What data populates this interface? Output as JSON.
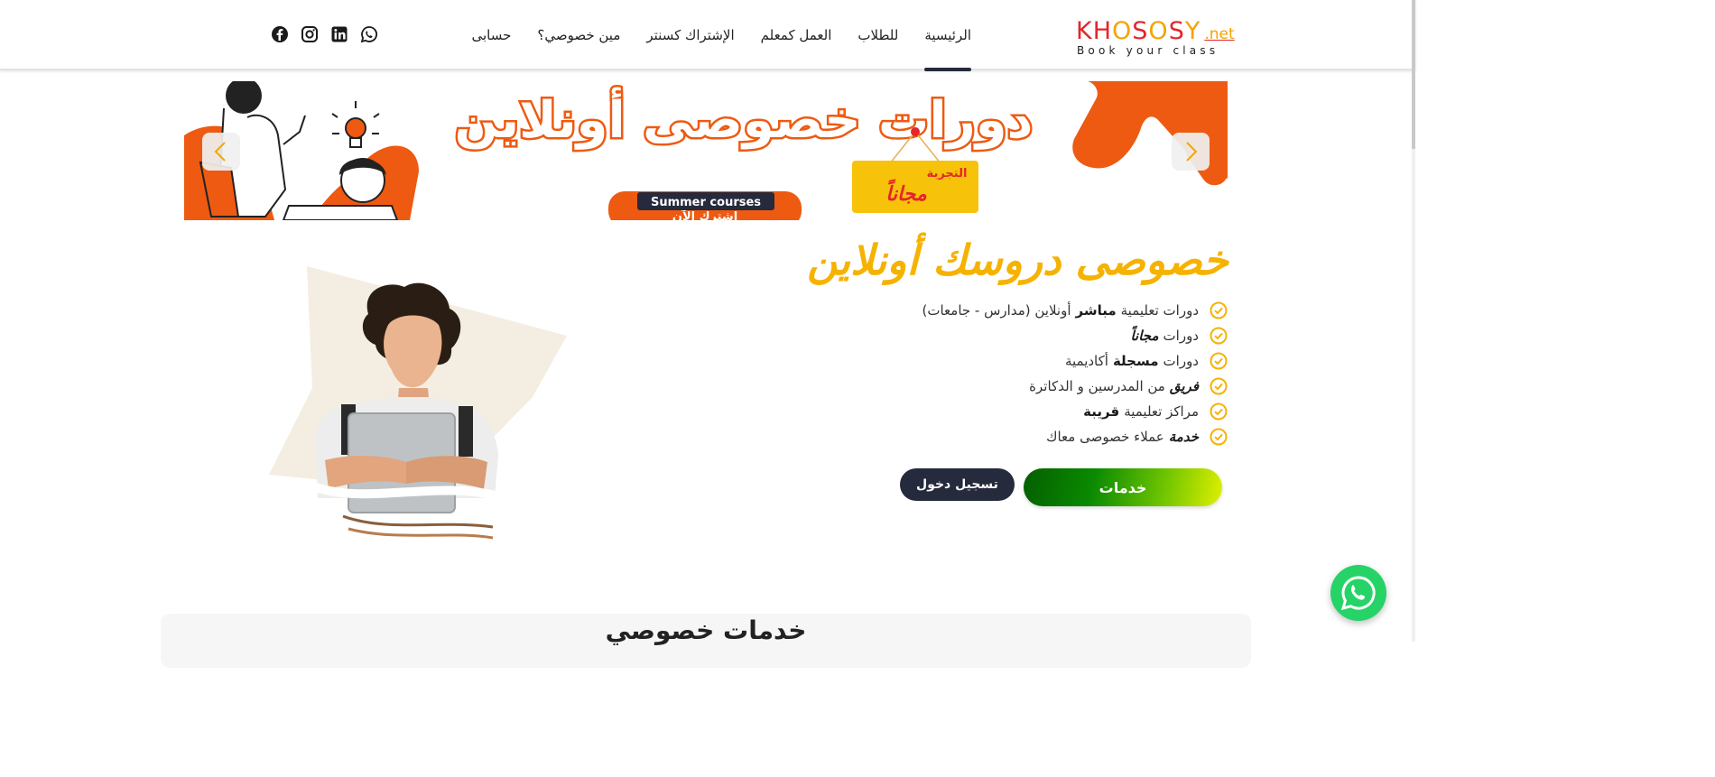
{
  "logo": {
    "text_main": "KHOSOSY",
    "text_net": ".net",
    "tagline": "Book your class"
  },
  "nav": {
    "items": [
      {
        "label": "الرئيسية",
        "active": true
      },
      {
        "label": "للطلاب"
      },
      {
        "label": "العمل كمعلم"
      },
      {
        "label": "الإشتراك كسنتر"
      },
      {
        "label": "مين خصوصي؟"
      },
      {
        "label": "حسابى"
      }
    ]
  },
  "social": [
    "whatsapp-icon",
    "linkedin-icon",
    "instagram-icon",
    "facebook-icon"
  ],
  "banner": {
    "headline": "دورات خصوصى أونلاين",
    "badge_small": "التجربة",
    "badge_big": "مجاناً",
    "pill_label": "Summer courses",
    "pill_sub": "اشترك الآن"
  },
  "hero": {
    "title": "خصوصى دروسك أونلاين",
    "features": [
      {
        "pre": "دورات تعليمية",
        "bold": "مباشر",
        "post": "أونلاين (مدارس - جامعات)"
      },
      {
        "pre": "دورات",
        "italic": "مجاناً",
        "post": ""
      },
      {
        "pre": "دورات",
        "bold": "مسجلة",
        "post": "أكاديمية"
      },
      {
        "pre": "",
        "italic": "فريق",
        "post": "من المدرسين و الدكاترة"
      },
      {
        "pre": "مراكز تعليمية",
        "bold": "قريبة",
        "post": ""
      },
      {
        "pre": "",
        "italic": "خدمة",
        "post": "عملاء خصوصى معاك"
      }
    ],
    "services_button": "خدمات",
    "login_button": "تسجيل دخول"
  },
  "services_section": {
    "title": "خدمات خصوصي"
  },
  "colors": {
    "accent": "#f6b200",
    "brand_red": "#e3262a",
    "dark": "#252a3d",
    "orange": "#ee5a11",
    "whatsapp": "#25d366"
  }
}
